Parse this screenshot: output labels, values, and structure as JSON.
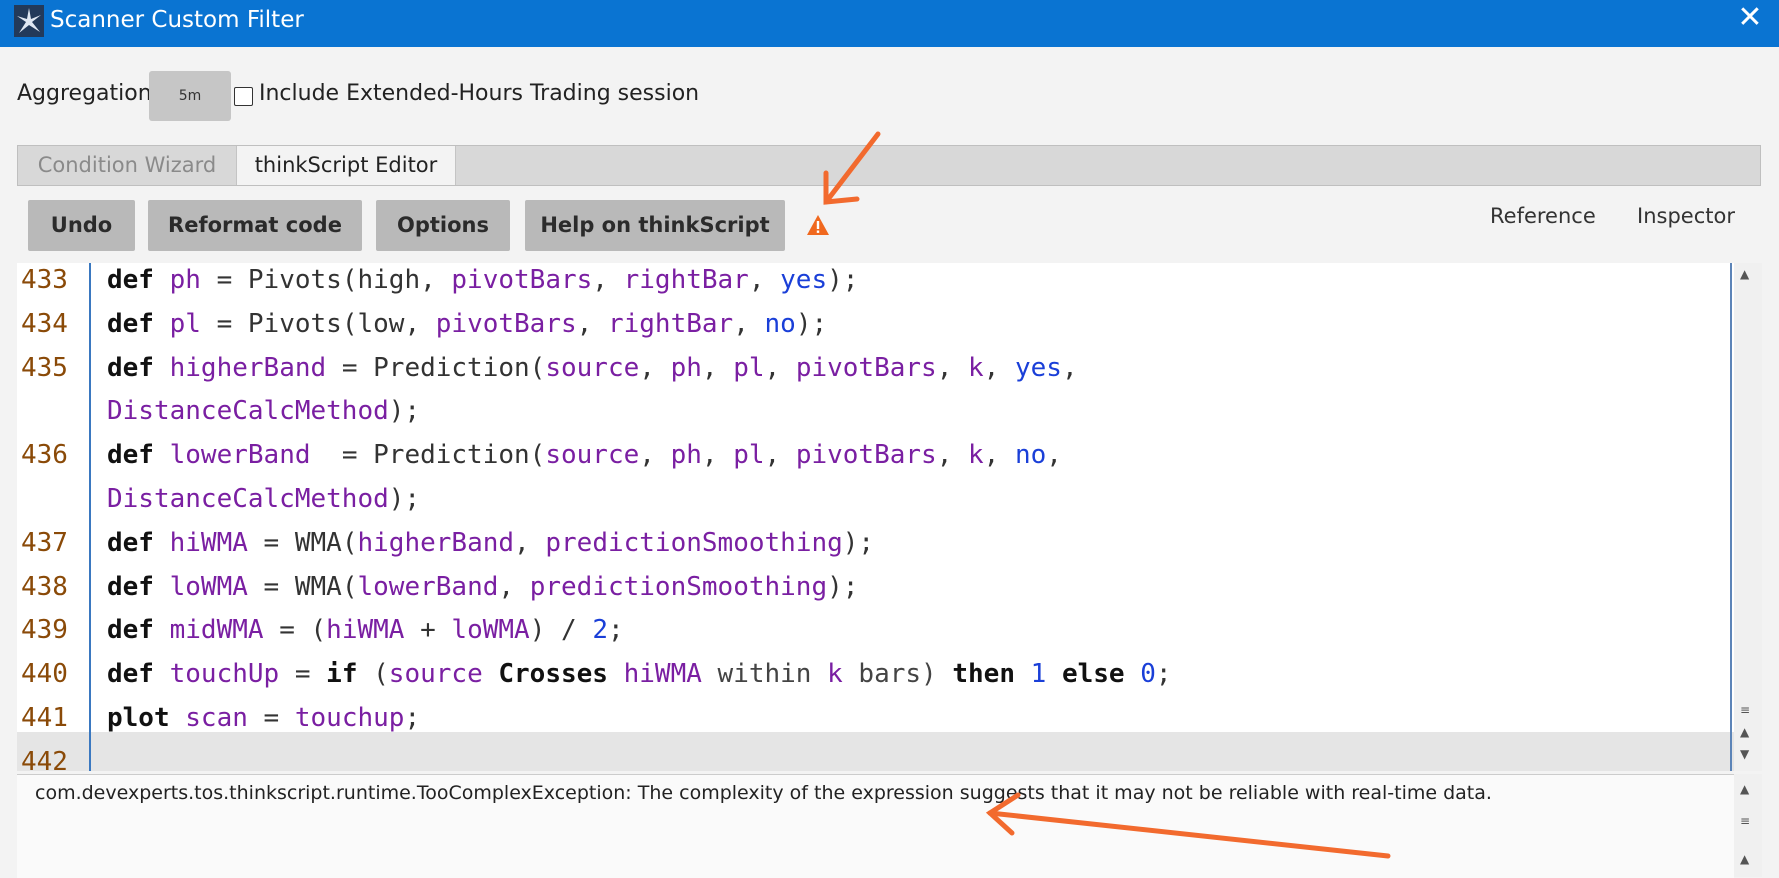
{
  "window": {
    "title": "Scanner Custom Filter",
    "close_glyph": "✕"
  },
  "aggregation": {
    "label": "Aggregation:",
    "value": "5m",
    "extended_label": "Include Extended-Hours Trading session"
  },
  "tabs": [
    {
      "label": "Condition Wizard",
      "active": false
    },
    {
      "label": "thinkScript Editor",
      "active": true
    }
  ],
  "toolbar": {
    "undo": "Undo",
    "reformat": "Reformat code",
    "options": "Options",
    "help": "Help on thinkScript",
    "reference": "Reference",
    "inspector": "Inspector",
    "warning_icon": "warning-triangle-icon"
  },
  "code_lines": [
    {
      "num": "433",
      "tokens": [
        [
          "kw",
          "def "
        ],
        [
          "vr",
          "ph"
        ],
        [
          "pl",
          " = "
        ],
        [
          "fn",
          "Pivots("
        ],
        [
          "fn",
          "high, "
        ],
        [
          "vr",
          "pivotBars"
        ],
        [
          "pl",
          ", "
        ],
        [
          "vr",
          "rightBar"
        ],
        [
          "pl",
          ", "
        ],
        [
          "nm",
          "yes"
        ],
        [
          "pl",
          ");"
        ]
      ]
    },
    {
      "num": "434",
      "tokens": [
        [
          "kw",
          "def "
        ],
        [
          "vr",
          "pl"
        ],
        [
          "pl",
          " = "
        ],
        [
          "fn",
          "Pivots("
        ],
        [
          "fn",
          "low, "
        ],
        [
          "vr",
          "pivotBars"
        ],
        [
          "pl",
          ", "
        ],
        [
          "vr",
          "rightBar"
        ],
        [
          "pl",
          ", "
        ],
        [
          "nm",
          "no"
        ],
        [
          "pl",
          ");"
        ]
      ]
    },
    {
      "num": "435",
      "tokens": [
        [
          "kw",
          "def "
        ],
        [
          "vr",
          "higherBand"
        ],
        [
          "pl",
          " = "
        ],
        [
          "fn",
          "Prediction("
        ],
        [
          "vr",
          "source"
        ],
        [
          "pl",
          ", "
        ],
        [
          "vr",
          "ph"
        ],
        [
          "pl",
          ", "
        ],
        [
          "vr",
          "pl"
        ],
        [
          "pl",
          ", "
        ],
        [
          "vr",
          "pivotBars"
        ],
        [
          "pl",
          ", "
        ],
        [
          "vr",
          "k"
        ],
        [
          "pl",
          ", "
        ],
        [
          "nm",
          "yes"
        ],
        [
          "pl",
          ","
        ]
      ]
    },
    {
      "num": "",
      "tokens": [
        [
          "vr",
          "DistanceCalcMethod"
        ],
        [
          "pl",
          ");"
        ]
      ]
    },
    {
      "num": "436",
      "tokens": [
        [
          "kw",
          "def "
        ],
        [
          "vr",
          "lowerBand"
        ],
        [
          "pl",
          "  = "
        ],
        [
          "fn",
          "Prediction("
        ],
        [
          "vr",
          "source"
        ],
        [
          "pl",
          ", "
        ],
        [
          "vr",
          "ph"
        ],
        [
          "pl",
          ", "
        ],
        [
          "vr",
          "pl"
        ],
        [
          "pl",
          ", "
        ],
        [
          "vr",
          "pivotBars"
        ],
        [
          "pl",
          ", "
        ],
        [
          "vr",
          "k"
        ],
        [
          "pl",
          ", "
        ],
        [
          "nm",
          "no"
        ],
        [
          "pl",
          ","
        ]
      ]
    },
    {
      "num": "",
      "tokens": [
        [
          "vr",
          "DistanceCalcMethod"
        ],
        [
          "pl",
          ");"
        ]
      ]
    },
    {
      "num": "437",
      "tokens": [
        [
          "kw",
          "def "
        ],
        [
          "vr",
          "hiWMA"
        ],
        [
          "pl",
          " = "
        ],
        [
          "fn",
          "WMA("
        ],
        [
          "vr",
          "higherBand"
        ],
        [
          "pl",
          ", "
        ],
        [
          "vr",
          "predictionSmoothing"
        ],
        [
          "pl",
          ");"
        ]
      ]
    },
    {
      "num": "438",
      "tokens": [
        [
          "kw",
          "def "
        ],
        [
          "vr",
          "loWMA"
        ],
        [
          "pl",
          " = "
        ],
        [
          "fn",
          "WMA("
        ],
        [
          "vr",
          "lowerBand"
        ],
        [
          "pl",
          ", "
        ],
        [
          "vr",
          "predictionSmoothing"
        ],
        [
          "pl",
          ");"
        ]
      ]
    },
    {
      "num": "439",
      "tokens": [
        [
          "kw",
          "def "
        ],
        [
          "vr",
          "midWMA"
        ],
        [
          "pl",
          " = ("
        ],
        [
          "vr",
          "hiWMA"
        ],
        [
          "pl",
          " + "
        ],
        [
          "vr",
          "loWMA"
        ],
        [
          "pl",
          ") / "
        ],
        [
          "nm",
          "2"
        ],
        [
          "pl",
          ";"
        ]
      ]
    },
    {
      "num": "440",
      "tokens": [
        [
          "kw",
          "def "
        ],
        [
          "vr",
          "touchUp"
        ],
        [
          "pl",
          " = "
        ],
        [
          "kw",
          "if"
        ],
        [
          "pl",
          " ("
        ],
        [
          "vr",
          "source"
        ],
        [
          "pl",
          " "
        ],
        [
          "kw",
          "Crosses"
        ],
        [
          "pl",
          " "
        ],
        [
          "vr",
          "hiWMA"
        ],
        [
          "gy",
          " within "
        ],
        [
          "vr",
          "k"
        ],
        [
          "gy",
          " bars) "
        ],
        [
          "kw",
          "then"
        ],
        [
          "pl",
          " "
        ],
        [
          "nm",
          "1"
        ],
        [
          "pl",
          " "
        ],
        [
          "kw",
          "else"
        ],
        [
          "pl",
          " "
        ],
        [
          "nm",
          "0"
        ],
        [
          "pl",
          ";"
        ]
      ]
    },
    {
      "num": "441",
      "tokens": [
        [
          "kw",
          "plot "
        ],
        [
          "vr",
          "scan"
        ],
        [
          "pl",
          " = "
        ],
        [
          "vr",
          "touchup"
        ],
        [
          "pl",
          ";"
        ]
      ]
    },
    {
      "num": "442",
      "tokens": []
    }
  ],
  "message": "com.devexperts.tos.thinkscript.runtime.TooComplexException: The complexity of the expression suggests that it may not be reliable with real-time data.",
  "colors": {
    "titlebar": "#0a74d2",
    "keyword": "#111111",
    "variable": "#7a1fa2",
    "number": "#1a3fd8",
    "line_number": "#8a4a08",
    "annotation_arrow": "#f26a2e"
  }
}
